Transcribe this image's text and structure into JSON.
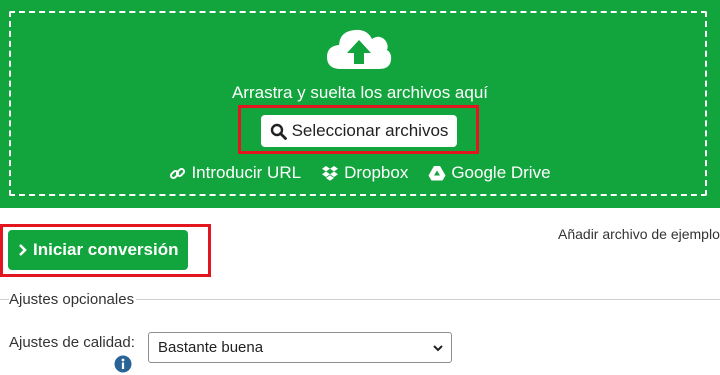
{
  "upload": {
    "drop_text": "Arrastra y suelta los archivos aquí",
    "select_button": "Seleccionar archivos",
    "icon": "cloud-upload-icon",
    "background_color": "#12a53e",
    "sources": [
      {
        "label": "Introducir URL",
        "icon": "link-icon"
      },
      {
        "label": "Dropbox",
        "icon": "dropbox-icon"
      },
      {
        "label": "Google Drive",
        "icon": "google-drive-icon"
      }
    ]
  },
  "actions": {
    "start_button": "Iniciar conversión",
    "sample_link": "Añadir archivo de ejemplo"
  },
  "options": {
    "legend": "Ajustes opcionales",
    "quality_label": "Ajustes de calidad:",
    "quality_value": "Bastante buena"
  },
  "highlight_color": "#e3161f"
}
